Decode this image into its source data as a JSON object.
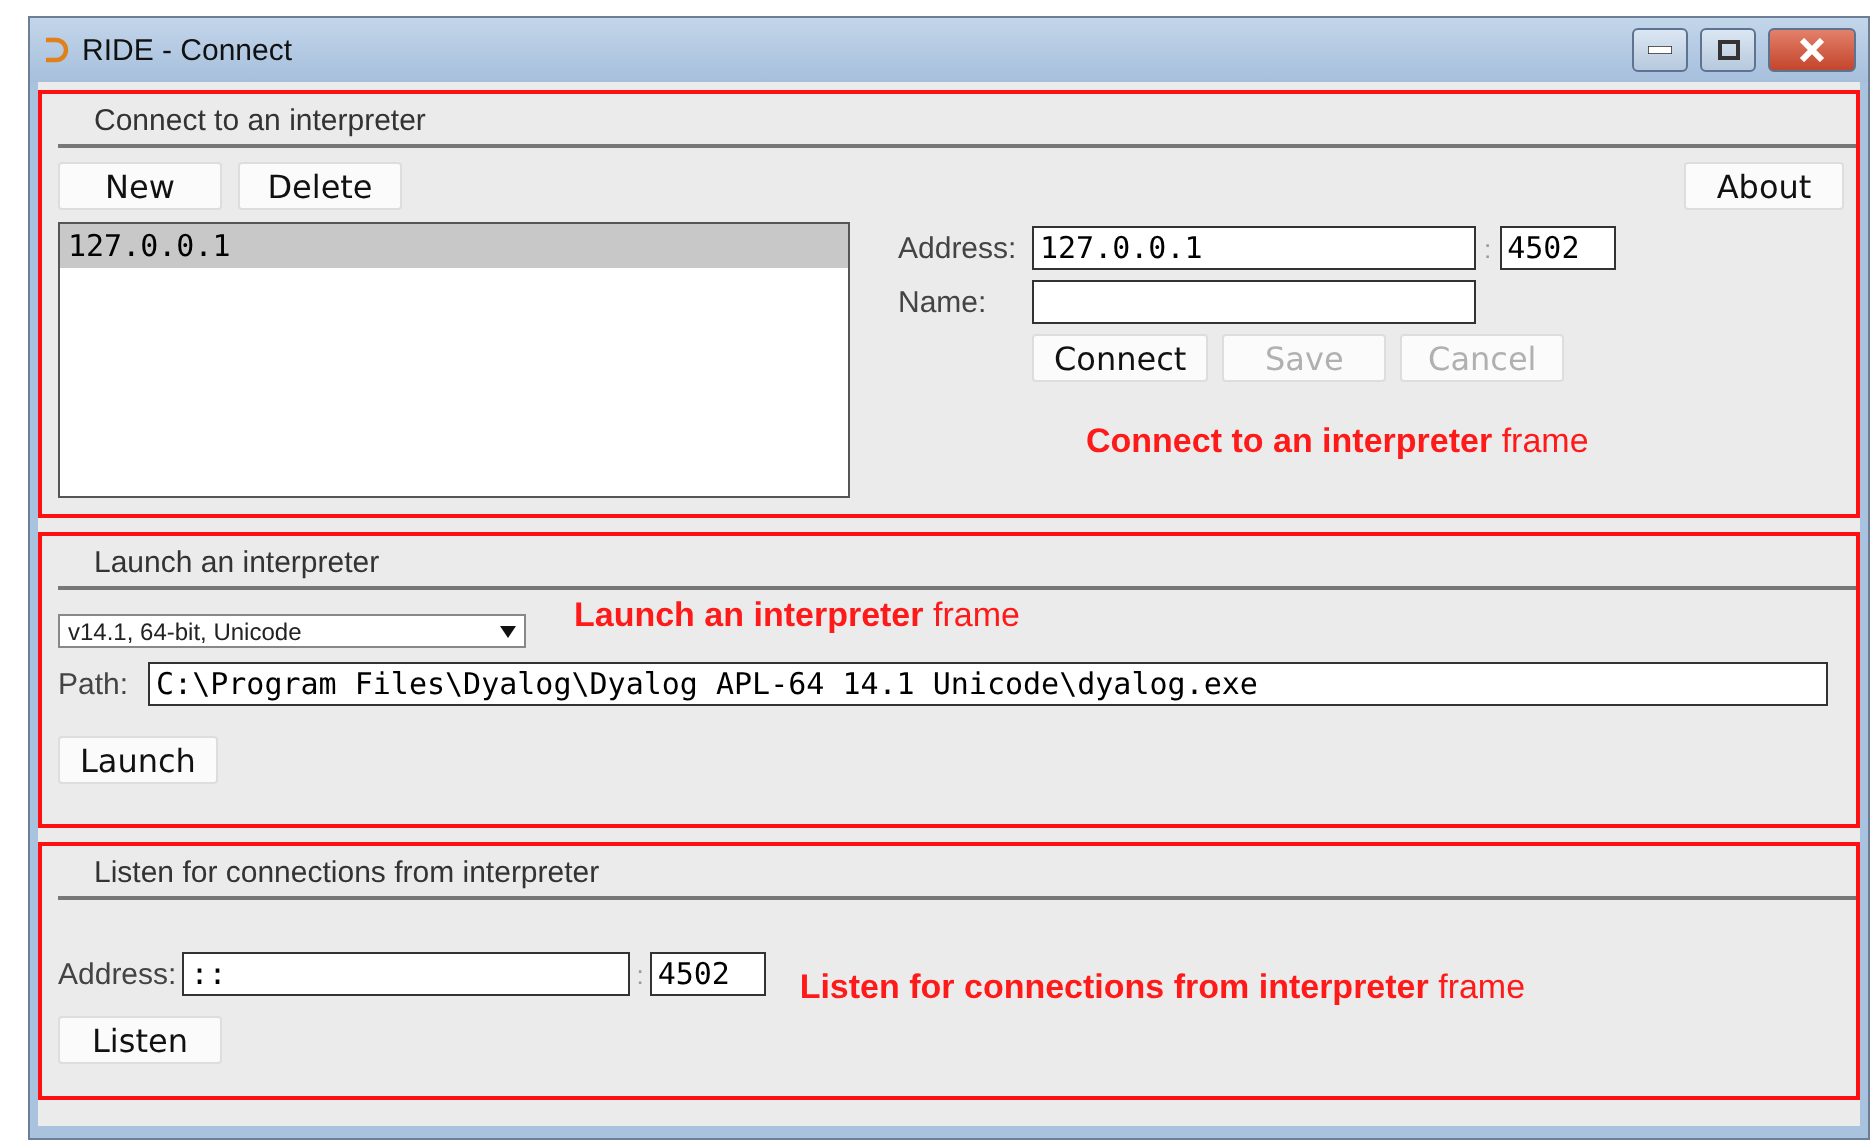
{
  "window": {
    "title": "RIDE - Connect"
  },
  "connect": {
    "title": "Connect to an interpreter",
    "buttons": [
      {
        "label": "New"
      },
      {
        "label": "Delete"
      }
    ],
    "about": "About",
    "list": [
      {
        "label": "127.0.0.1",
        "selected": true
      }
    ],
    "address_label": "Address:",
    "address": "127.0.0.1",
    "separator": ":",
    "port": "4502",
    "name_label": "Name:",
    "actions": [
      {
        "label": "Connect",
        "disabled": false
      },
      {
        "label": "Save",
        "disabled": true
      },
      {
        "label": "Cancel",
        "disabled": true
      }
    ],
    "annotation": "**Connect to an interpreter** frame"
  },
  "launch": {
    "title": "Launch an interpreter",
    "version": "v14.1, 64-bit, Unicode",
    "path_label": "Path:",
    "path": "C:\\Program Files\\Dyalog\\Dyalog APL-64 14.1 Unicode\\dyalog.exe",
    "button": "Launch",
    "annotation": "**Launch an interpreter** frame"
  },
  "listen": {
    "title": "Listen for connections from interpreter",
    "address_label": "Address:",
    "address": "::",
    "separator": ":",
    "port": "4502",
    "button": "Listen",
    "annotation": "**Listen for connections from interpreter** frame"
  }
}
